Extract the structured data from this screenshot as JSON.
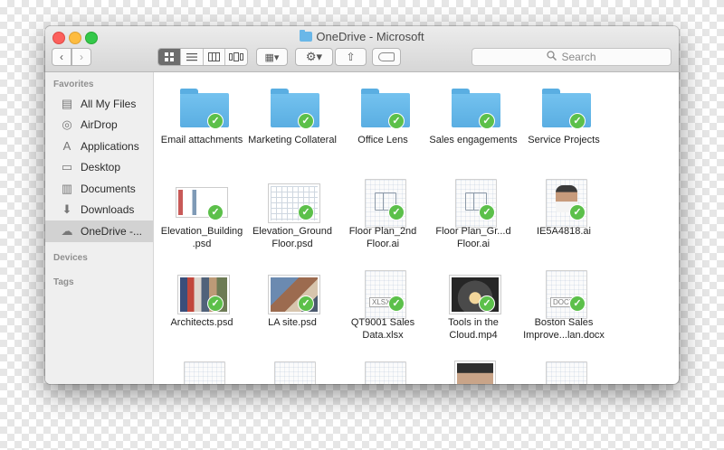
{
  "window": {
    "title": "OneDrive - Microsoft"
  },
  "toolbar": {
    "back_glyph": "‹",
    "forward_glyph": "›",
    "view_modes": [
      "icon",
      "list",
      "column",
      "cover-flow"
    ],
    "active_view": "icon",
    "arrange_glyph": "▦▾",
    "action_glyph": "⚙▾",
    "share_glyph": "⇧"
  },
  "search": {
    "placeholder": "Search"
  },
  "sidebar": {
    "favorites_heading": "Favorites",
    "items": [
      {
        "label": "All My Files",
        "icon": "all-files-icon",
        "glyph": "▤"
      },
      {
        "label": "AirDrop",
        "icon": "airdrop-icon",
        "glyph": "◎"
      },
      {
        "label": "Applications",
        "icon": "applications-icon",
        "glyph": "A"
      },
      {
        "label": "Desktop",
        "icon": "desktop-icon",
        "glyph": "▭"
      },
      {
        "label": "Documents",
        "icon": "documents-icon",
        "glyph": "▥"
      },
      {
        "label": "Downloads",
        "icon": "downloads-icon",
        "glyph": "⬇"
      },
      {
        "label": "OneDrive -...",
        "icon": "cloud-icon",
        "glyph": "☁",
        "selected": true
      }
    ],
    "devices_heading": "Devices",
    "tags_heading": "Tags"
  },
  "files": [
    {
      "name": "Email attachments",
      "kind": "folder",
      "synced": true
    },
    {
      "name": "Marketing Collateral",
      "kind": "folder",
      "synced": true
    },
    {
      "name": "Office Lens",
      "kind": "folder",
      "synced": true
    },
    {
      "name": "Sales engagements",
      "kind": "folder",
      "synced": true
    },
    {
      "name": "Service Projects",
      "kind": "folder",
      "synced": true
    },
    {
      "name": "Elevation_Building .psd",
      "kind": "psd-floor",
      "synced": true
    },
    {
      "name": "Elevation_Ground Floor.psd",
      "kind": "psd-blueprint",
      "synced": true
    },
    {
      "name": "Floor Plan_2nd Floor.ai",
      "kind": "ai-plan",
      "synced": true
    },
    {
      "name": "Floor Plan_Gr...d Floor.ai",
      "kind": "ai-plan",
      "synced": true
    },
    {
      "name": "IE5A4818.ai",
      "kind": "ai-portrait",
      "synced": true
    },
    {
      "name": "Architects.psd",
      "kind": "psd-clothes",
      "synced": true
    },
    {
      "name": "LA site.psd",
      "kind": "psd-lasite",
      "synced": true
    },
    {
      "name": "QT9001 Sales Data.xlsx",
      "kind": "xlsx",
      "ext": "XLSX",
      "synced": true
    },
    {
      "name": "Tools in the Cloud.mp4",
      "kind": "mp4",
      "synced": true
    },
    {
      "name": "Boston Sales Improve...lan.docx",
      "kind": "docx",
      "ext": "DOCX",
      "synced": true
    },
    {
      "name": "",
      "kind": "doc-text",
      "synced": false
    },
    {
      "name": "",
      "kind": "doc-text",
      "synced": false
    },
    {
      "name": "",
      "kind": "doc-plain",
      "synced": false
    },
    {
      "name": "",
      "kind": "photo-portrait",
      "synced": false
    },
    {
      "name": "",
      "kind": "doc-plain",
      "synced": false
    }
  ],
  "colors": {
    "folder_blue": "#5aaee2",
    "sync_check": "#5cc04a",
    "sidebar_selected": "#d2d2d2"
  }
}
